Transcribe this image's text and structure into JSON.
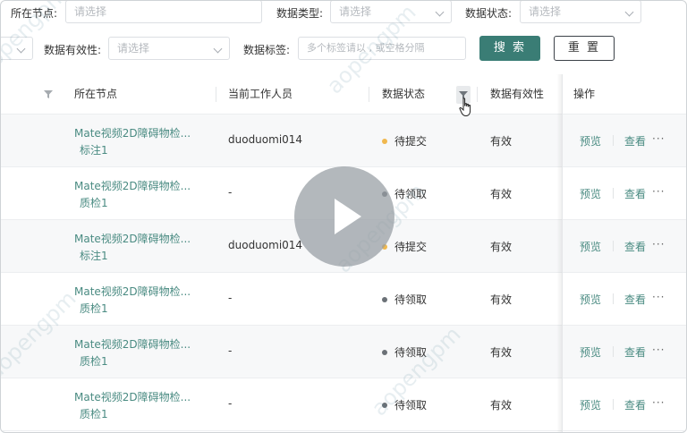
{
  "filters": {
    "row1": [
      {
        "label": "所在节点:",
        "placeholder": "请选择"
      },
      {
        "label": "数据类型:",
        "placeholder": "请选择"
      },
      {
        "label": "数据状态:",
        "placeholder": "请选择"
      }
    ],
    "row2": [
      {
        "label": "数据有效性:",
        "placeholder": "请选择"
      },
      {
        "label": "数据标签:",
        "placeholder": "多个标签请以 , 或空格分隔"
      }
    ],
    "search_label": "搜 索",
    "reset_label": "重 置"
  },
  "table": {
    "columns": [
      "所在节点",
      "当前工作人员",
      "数据状态",
      "数据有效性",
      "操作"
    ],
    "rows": [
      {
        "node": "Mate视频2D障碍物检...",
        "stage": "标注1",
        "person": "duoduomi014",
        "status": "待提交",
        "validity": "有效"
      },
      {
        "node": "Mate视频2D障碍物检...",
        "stage": "质检1",
        "person": "-",
        "status": "待领取",
        "validity": "有效"
      },
      {
        "node": "Mate视频2D障碍物检...",
        "stage": "标注1",
        "person": "duoduomi014",
        "status": "待提交",
        "validity": "有效"
      },
      {
        "node": "Mate视频2D障碍物检...",
        "stage": "质检1",
        "person": "-",
        "status": "待领取",
        "validity": "有效"
      },
      {
        "node": "Mate视频2D障碍物检...",
        "stage": "质检1",
        "person": "-",
        "status": "待领取",
        "validity": "有效"
      },
      {
        "node": "Mate视频2D障碍物检...",
        "stage": "质检1",
        "person": "-",
        "status": "待领取",
        "validity": "有效"
      }
    ],
    "actions": {
      "preview": "预览",
      "view": "查看",
      "more": "···"
    }
  },
  "status_colors": {
    "待提交": "#f0b84e",
    "待领取": "#6b7177"
  },
  "watermark": "aopengpm",
  "accent": "#3a7d75"
}
